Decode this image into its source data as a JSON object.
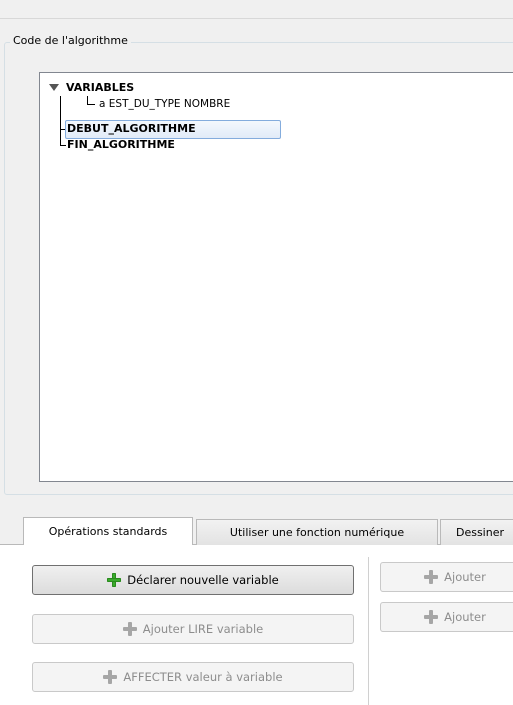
{
  "group": {
    "title": "Code de l'algorithme"
  },
  "tree": {
    "variables": "VARIABLES",
    "var_a": "a EST_DU_TYPE NOMBRE",
    "debut": "DEBUT_ALGORITHME",
    "fin": "FIN_ALGORITHME",
    "selected_node": "DEBUT_ALGORITHME"
  },
  "tabs": [
    {
      "label": "Opérations standards",
      "active": true
    },
    {
      "label": "Utiliser une fonction numérique",
      "active": false
    },
    {
      "label": "Dessiner",
      "active": false
    }
  ],
  "buttons": {
    "declare_var": "Déclarer nouvelle variable",
    "lire_var": "Ajouter LIRE variable",
    "affecter_var": "AFFECTER valeur à variable",
    "ajouter_1": "Ajouter",
    "ajouter_2": "Ajouter"
  },
  "colors": {
    "plus_enabled": "#3aaa2c",
    "plus_disabled": "#a6a6a6",
    "selection_border": "#84acdd"
  }
}
